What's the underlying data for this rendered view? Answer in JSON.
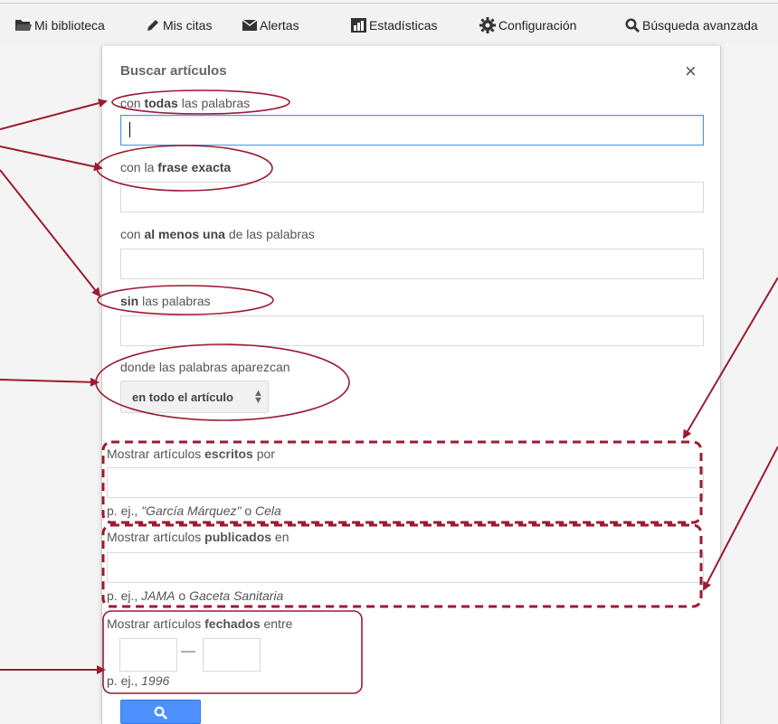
{
  "nav": {
    "items": [
      {
        "label": "Mi biblioteca",
        "icon": "folder-icon"
      },
      {
        "label": "Mis citas",
        "icon": "pencil-icon"
      },
      {
        "label": "Alertas",
        "icon": "envelope-icon"
      },
      {
        "label": "Estadísticas",
        "icon": "bar-chart-icon"
      },
      {
        "label": "Configuración",
        "icon": "gear-icon"
      },
      {
        "label": "Búsqueda avanzada",
        "icon": "search-icon"
      }
    ]
  },
  "dialog": {
    "title": "Buscar artículos",
    "close_label": "×",
    "all_words": {
      "pre": "con ",
      "bold": "todas",
      "post": " las palabras",
      "value": ""
    },
    "exact_phrase": {
      "pre": "con la ",
      "bold": "frase exacta",
      "post": "",
      "value": ""
    },
    "at_least_one": {
      "pre": "con ",
      "bold": "al menos una",
      "post": " de las palabras",
      "value": ""
    },
    "without": {
      "pre": "",
      "bold": "sin",
      "post": " las palabras",
      "value": ""
    },
    "where": {
      "label": "donde las palabras aparezcan",
      "selected": "en todo el artículo"
    },
    "author": {
      "pre": "Mostrar artículos ",
      "bold": "escritos",
      "post": " por",
      "hint_pre": "p. ej., ",
      "hint_a": "\"García Márquez\"",
      "hint_mid": " o ",
      "hint_b": "Cela",
      "value": ""
    },
    "publication": {
      "pre": "Mostrar artículos ",
      "bold": "publicados",
      "post": " en",
      "hint_pre": "p. ej., ",
      "hint_a": "JAMA",
      "hint_mid": " o ",
      "hint_b": "Gaceta Sanitaria",
      "value": ""
    },
    "dates": {
      "pre": "Mostrar artículos ",
      "bold": "fechados",
      "post": " entre",
      "dash": "—",
      "hint_pre": "p. ej., ",
      "hint_a": "1996",
      "from": "",
      "to": ""
    }
  },
  "colors": {
    "annotation": "#9b1b30",
    "accent": "#4d90fe"
  }
}
